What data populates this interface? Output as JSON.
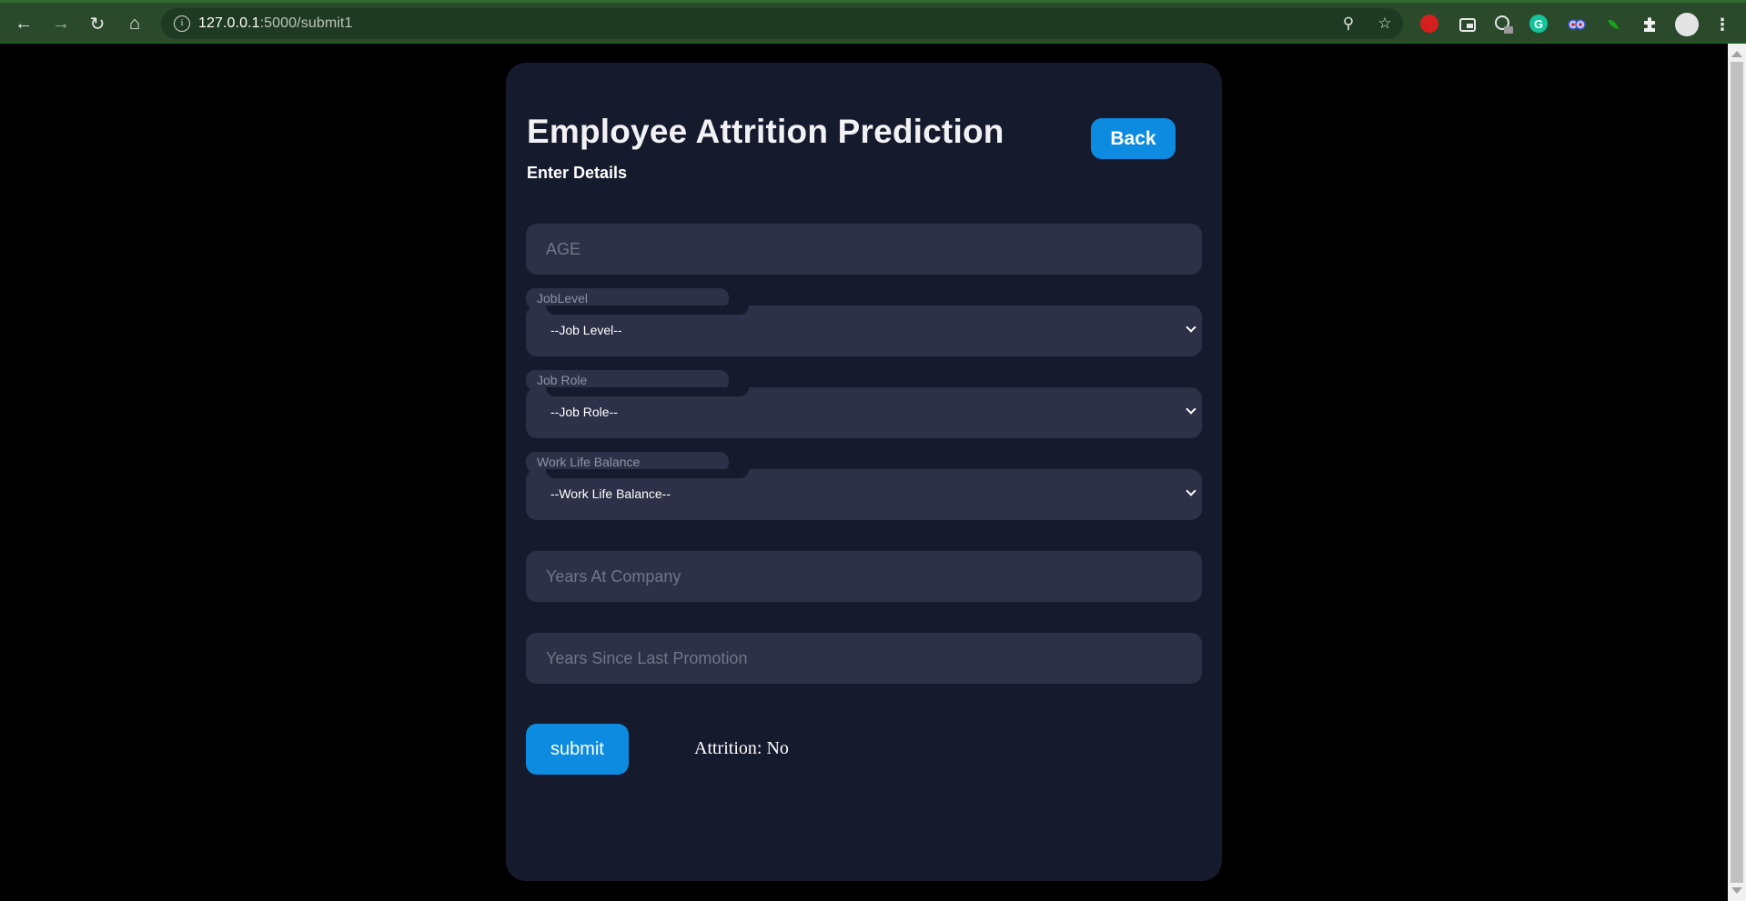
{
  "browser": {
    "url_host": "127.0.0.1",
    "url_path": ":5000/submit1"
  },
  "page": {
    "title": "Employee Attrition Prediction",
    "subtitle": "Enter Details",
    "back_label": "Back",
    "age_placeholder": "AGE",
    "job_level_label": "JobLevel",
    "job_level_value": "--Job Level--",
    "job_role_label": "Job Role",
    "job_role_value": "--Job Role--",
    "wlb_label": "Work Life Balance",
    "wlb_value": "--Work Life Balance--",
    "years_at_company_placeholder": "Years At Company",
    "years_since_promo_placeholder": "Years Since Last Promotion",
    "submit_label": "submit",
    "result_text": "Attrition: No"
  }
}
